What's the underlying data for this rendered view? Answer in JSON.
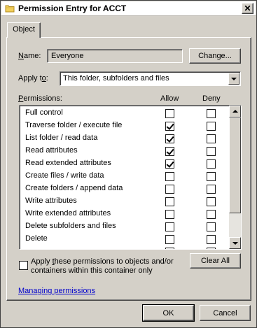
{
  "window": {
    "title": "Permission Entry for ACCT"
  },
  "tabs": [
    {
      "label": "Object"
    }
  ],
  "name": {
    "label_prefix": "",
    "label_ul": "N",
    "label_rest": "ame:",
    "value": "Everyone",
    "change_button": "Change..."
  },
  "apply_to": {
    "label_prefix": "Apply t",
    "label_ul": "o",
    "label_rest": ":",
    "value": "This folder, subfolders and files"
  },
  "permissions": {
    "label_ul": "P",
    "label_rest": "ermissions:",
    "allow_header": "Allow",
    "deny_header": "Deny",
    "items": [
      {
        "name": "Full control",
        "allow": false,
        "deny": false
      },
      {
        "name": "Traverse folder / execute file",
        "allow": true,
        "deny": false
      },
      {
        "name": "List folder / read data",
        "allow": true,
        "deny": false
      },
      {
        "name": "Read attributes",
        "allow": true,
        "deny": false
      },
      {
        "name": "Read extended attributes",
        "allow": true,
        "deny": false
      },
      {
        "name": "Create files / write data",
        "allow": false,
        "deny": false
      },
      {
        "name": "Create folders / append data",
        "allow": false,
        "deny": false
      },
      {
        "name": "Write attributes",
        "allow": false,
        "deny": false
      },
      {
        "name": "Write extended attributes",
        "allow": false,
        "deny": false
      },
      {
        "name": "Delete subfolders and files",
        "allow": false,
        "deny": false
      },
      {
        "name": "Delete",
        "allow": false,
        "deny": false
      },
      {
        "name": "",
        "allow": false,
        "deny": false
      }
    ]
  },
  "apply_inherit": {
    "line1_prefix": "Apply ",
    "line1_ul": "t",
    "line1_rest": "hese permissions to objects and/or",
    "line2": "containers within this container only",
    "checked": false
  },
  "clear_all_button": "Clear All",
  "managing_link": "Managing permissions",
  "footer": {
    "ok": "OK",
    "cancel": "Cancel"
  },
  "icons": {
    "title": "folder-icon",
    "close": "close-icon"
  }
}
